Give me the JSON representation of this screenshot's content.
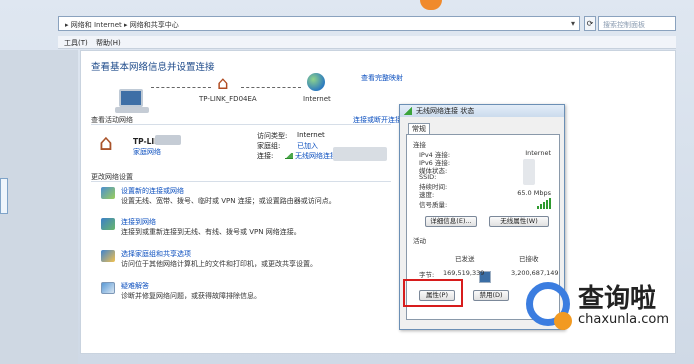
{
  "address_bar": {
    "path": "▸ 网络和 Internet ▸ 网络和共享中心",
    "dropdown": "▾"
  },
  "search": {
    "placeholder": "搜索控制面板"
  },
  "menu": {
    "tools": "工具(T)",
    "help": "帮助(H)"
  },
  "main": {
    "title": "查看基本网络信息并设置连接",
    "full_map_link": "查看完整映射",
    "map_router_label": "TP-LINK_FD04EA",
    "map_internet_label": "Internet",
    "active_networks_title": "查看活动网络",
    "connect_disconnect_link": "连接或断开连接",
    "network_name": "TP-LIN",
    "network_type": "家庭网络",
    "access_type_label": "访问类型:",
    "access_type_value": "Internet",
    "homegroup_label": "家庭组:",
    "homegroup_value": "已加入",
    "connection_label": "连接:",
    "connection_value": "无线网络连接",
    "change_settings_title": "更改网络设置",
    "tasks": [
      {
        "link": "设置新的连接或网络",
        "desc": "设置无线、宽带、拨号、临时或 VPN 连接；或设置路由器或访问点。"
      },
      {
        "link": "连接到网络",
        "desc": "连接到或重新连接到无线、有线、拨号或 VPN 网络连接。"
      },
      {
        "link": "选择家庭组和共享选项",
        "desc": "访问位于其他网络计算机上的文件和打印机，或更改共享设置。"
      },
      {
        "link": "疑难解答",
        "desc": "诊断并修复网络问题，或获得故障排除信息。"
      }
    ]
  },
  "dialog": {
    "title": "无线网络连接 状态",
    "tab_general": "常规",
    "section_connection": "连接",
    "rows": [
      {
        "label": "IPv4 连接:",
        "value": "Internet"
      },
      {
        "label": "IPv6 连接:",
        "value": ""
      },
      {
        "label": "媒体状态:",
        "value": ""
      },
      {
        "label": "SSID:",
        "value": ""
      },
      {
        "label": "持续时间:",
        "value": ""
      },
      {
        "label": "速度:",
        "value": "65.0 Mbps"
      }
    ],
    "signal_label": "信号质量:",
    "details_button": "详细信息(E)...",
    "wireless_props_button": "无线属性(W)",
    "section_activity": "活动",
    "sent_label": "已发送",
    "received_label": "已接收",
    "bytes_label": "字节:",
    "bytes_sent": "169,519,339",
    "bytes_received": "3,200,687,149",
    "properties_button": "属性(P)",
    "disable_button": "禁用(D)"
  },
  "watermark": {
    "title": "查询啦",
    "url": "chaxunla.com"
  }
}
